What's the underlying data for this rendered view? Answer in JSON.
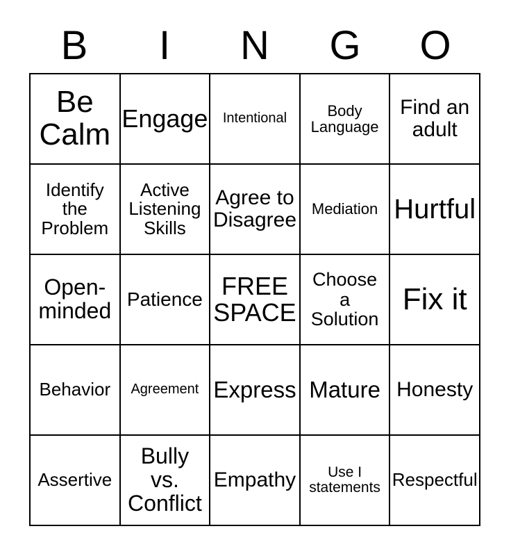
{
  "card": {
    "title": "BINGO",
    "header_letters": [
      "B",
      "I",
      "N",
      "G",
      "O"
    ],
    "free_space_text": "FREE\nSPACE",
    "colors": {
      "grid_line": "#000000",
      "cell_background": "#ffffff",
      "text": "#000000",
      "page_background": "#ffffff"
    },
    "grid": {
      "columns": 5,
      "rows": 5,
      "cells": [
        [
          {
            "text": "Be\nCalm",
            "size": "fs-6xl"
          },
          {
            "text": "Engage",
            "size": "fs-4xl"
          },
          {
            "text": "Intentional",
            "size": "fs-xxs"
          },
          {
            "text": "Body\nLanguage",
            "size": "fs-s"
          },
          {
            "text": "Find an\nadult",
            "size": "fs-xl"
          }
        ],
        [
          {
            "text": "Identify\nthe\nProblem",
            "size": "fs-m"
          },
          {
            "text": "Active\nListening\nSkills",
            "size": "fs-m"
          },
          {
            "text": "Agree to\nDisagree",
            "size": "fs-xl"
          },
          {
            "text": "Mediation",
            "size": "fs-s"
          },
          {
            "text": "Hurtful",
            "size": "fs-5xl"
          }
        ],
        [
          {
            "text": "Open-\nminded",
            "size": "fs-xxl"
          },
          {
            "text": "Patience",
            "size": "fs-l"
          },
          {
            "text": "FREE\nSPACE",
            "size": "fs-4xl"
          },
          {
            "text": "Choose\na\nSolution",
            "size": "fs-ml"
          },
          {
            "text": "Fix it",
            "size": "fs-6xl"
          }
        ],
        [
          {
            "text": "Behavior",
            "size": "fs-m"
          },
          {
            "text": "Agreement",
            "size": "fs-xxs"
          },
          {
            "text": "Express",
            "size": "fs-3xl"
          },
          {
            "text": "Mature",
            "size": "fs-3xl"
          },
          {
            "text": "Honesty",
            "size": "fs-xl"
          }
        ],
        [
          {
            "text": "Assertive",
            "size": "fs-m"
          },
          {
            "text": "Bully\nvs.\nConflict",
            "size": "fs-xxl"
          },
          {
            "text": "Empathy",
            "size": "fs-xl"
          },
          {
            "text": "Use I\nstatements",
            "size": "fs-xs"
          },
          {
            "text": "Respectful",
            "size": "fs-m"
          }
        ]
      ]
    }
  }
}
